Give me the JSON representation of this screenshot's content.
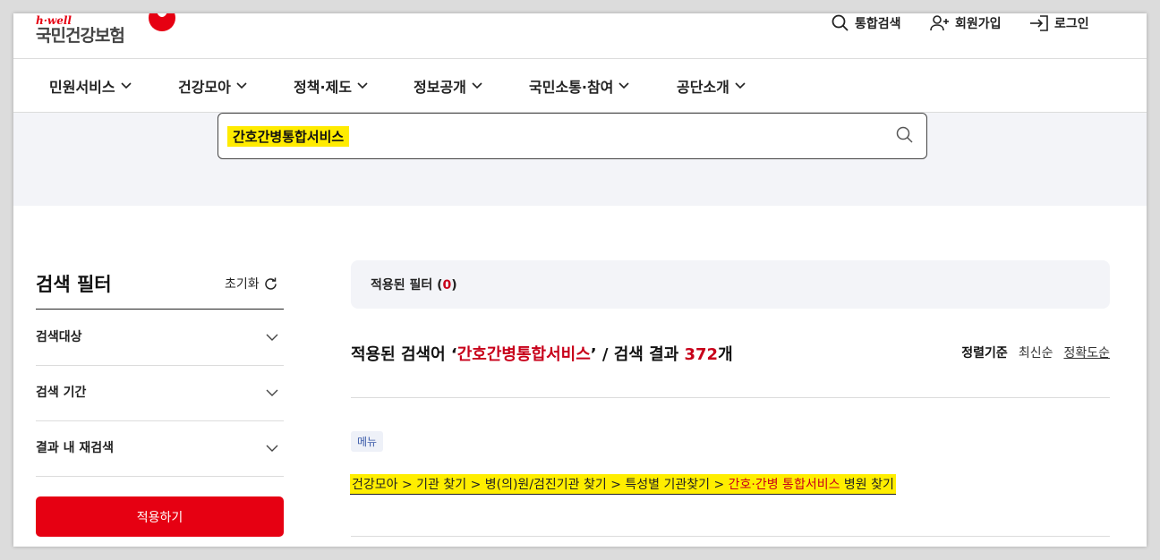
{
  "header": {
    "logo_brand": "h·well",
    "logo_name": "국민건강보험",
    "util": {
      "search_label": "통합검색",
      "signup_label": "회원가입",
      "login_label": "로그인"
    }
  },
  "nav": {
    "items": [
      {
        "label": "민원서비스"
      },
      {
        "label": "건강모아"
      },
      {
        "label": "정책·제도"
      },
      {
        "label": "정보공개"
      },
      {
        "label": "국민소통·참여"
      },
      {
        "label": "공단소개"
      }
    ]
  },
  "search": {
    "value": "간호간병통합서비스"
  },
  "filter": {
    "title": "검색 필터",
    "reset_label": "초기화",
    "items": [
      {
        "label": "검색대상"
      },
      {
        "label": "검색 기간"
      },
      {
        "label": "결과 내 재검색"
      }
    ],
    "apply_label": "적용하기"
  },
  "results": {
    "applied_prefix": "적용된 필터 (",
    "applied_count": "0",
    "applied_suffix": ")",
    "head_prefix": "적용된 검색어 ‘",
    "keyword": "간호간병통합서비스",
    "head_middle": "’ / 검색 결과 ",
    "count": "372",
    "head_suffix": "개",
    "sort_label": "정렬기준",
    "sort_options": [
      "최신순",
      "정확도순"
    ],
    "item": {
      "badge": "메뉴",
      "path_prefix": "건강모아 > 기관 찾기 > 병(의)원/검진기관 찾기 > 특성별 기관찾기 > ",
      "path_highlight": "간호·간병 통합서비스",
      "path_suffix": " 병원 찾기"
    }
  },
  "colors": {
    "brand_red": "#e60012",
    "highlight_yellow": "#ffeb00",
    "band_bg": "#f3f4f8"
  }
}
